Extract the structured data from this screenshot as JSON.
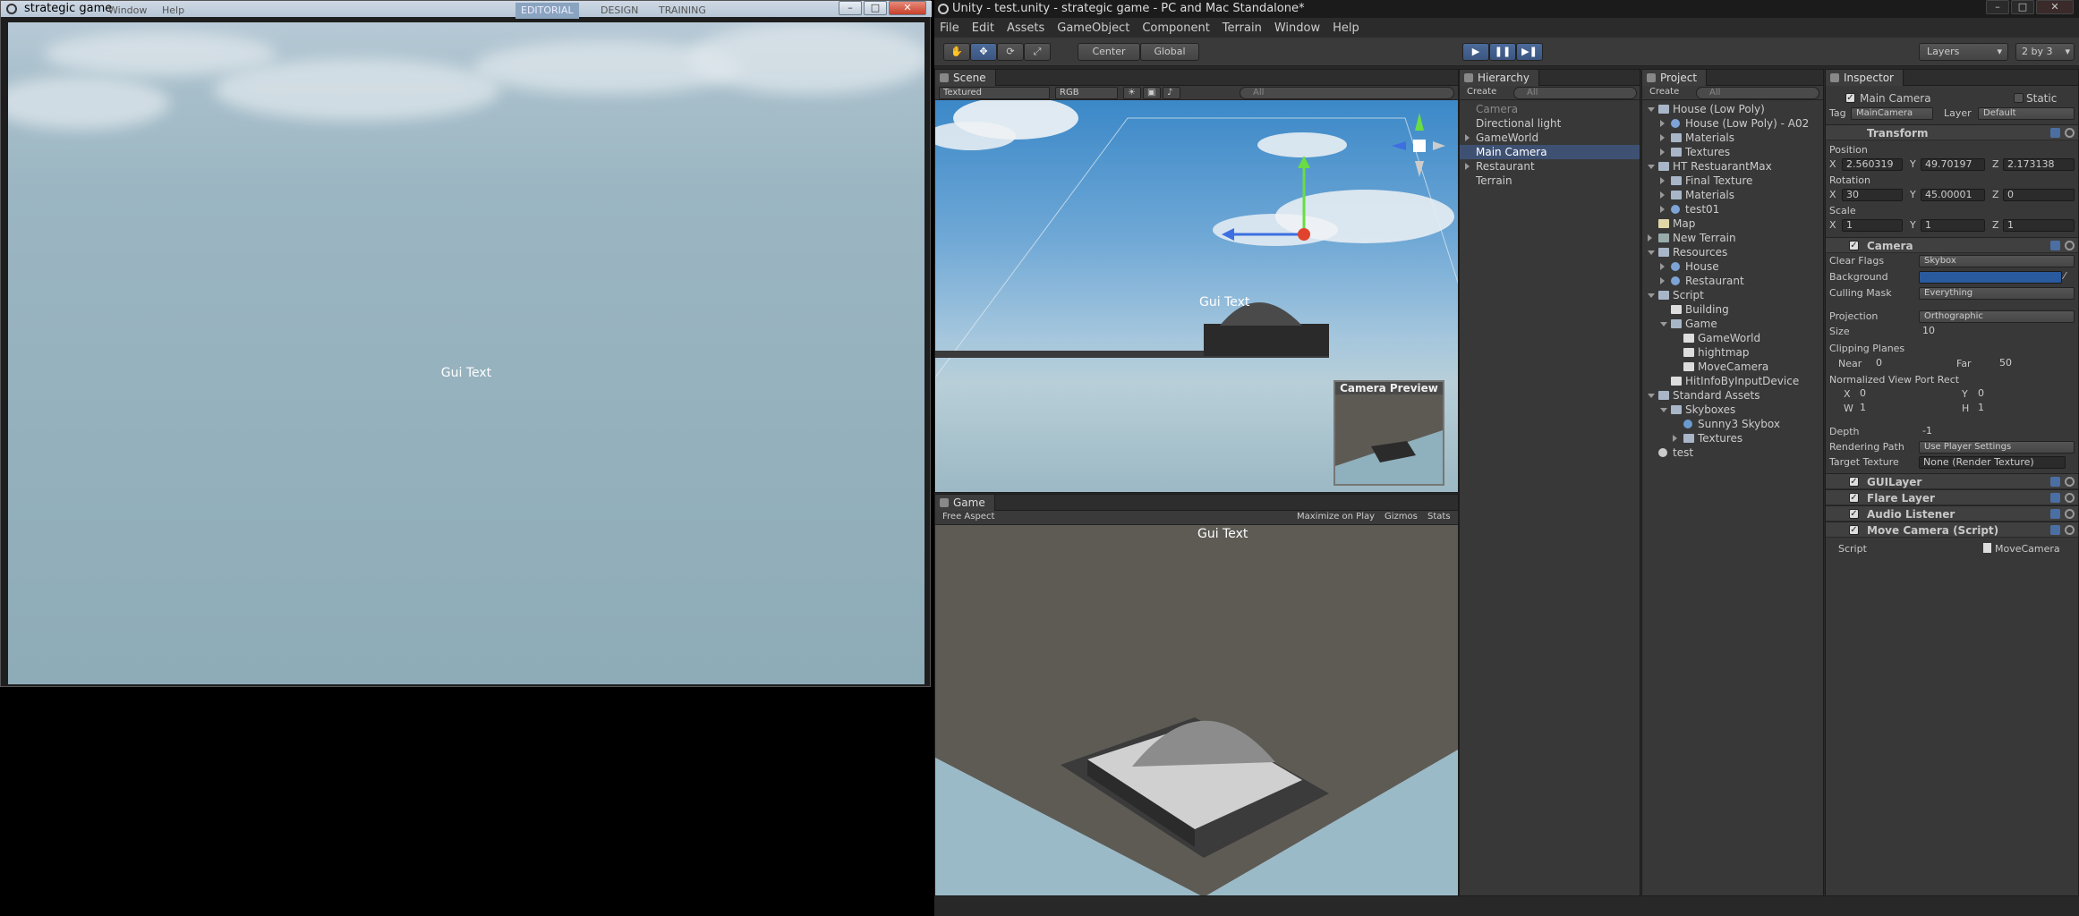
{
  "player": {
    "title": "strategic game",
    "ghost_menu": [
      "Window",
      "Help"
    ],
    "ghost_tabs": [
      "EDITORIAL",
      "DESIGN",
      "TRAINING"
    ],
    "gui_text": "Gui Text",
    "buttons": {
      "minimize": "–",
      "maximize": "□",
      "close": "✕"
    }
  },
  "editor": {
    "title": "Unity - test.unity - strategic game - PC and Mac Standalone*",
    "menu": [
      "File",
      "Edit",
      "Assets",
      "GameObject",
      "Component",
      "Terrain",
      "Window",
      "Help"
    ],
    "toolbar": {
      "center": "Center",
      "global": "Global",
      "layers": "Layers",
      "layout": "2 by 3"
    },
    "scene": {
      "tab": "Scene",
      "render_mode": "Textured",
      "color_mode": "RGB",
      "search": "All",
      "gui_text": "Gui Text",
      "camera_preview": "Camera Preview"
    },
    "game": {
      "tab": "Game",
      "aspect": "Free Aspect",
      "maximize": "Maximize on Play",
      "gizmos": "Gizmos",
      "stats": "Stats",
      "gui_text": "Gui Text"
    },
    "hierarchy": {
      "tab": "Hierarchy",
      "create": "Create",
      "search": "All",
      "items": [
        {
          "label": "Camera",
          "indent": 0,
          "fold": "none",
          "dim": true
        },
        {
          "label": "Directional light",
          "indent": 0,
          "fold": "none"
        },
        {
          "label": "GameWorld",
          "indent": 0,
          "fold": "closed"
        },
        {
          "label": "Main Camera",
          "indent": 0,
          "fold": "none",
          "selected": true
        },
        {
          "label": "Restaurant",
          "indent": 0,
          "fold": "closed"
        },
        {
          "label": "Terrain",
          "indent": 0,
          "fold": "none"
        }
      ]
    },
    "project": {
      "tab": "Project",
      "create": "Create",
      "search": "All",
      "items": [
        {
          "label": "House (Low Poly)",
          "indent": 0,
          "fold": "open",
          "icon": "folder"
        },
        {
          "label": "House (Low Poly) - A02",
          "indent": 1,
          "fold": "closed",
          "icon": "prefab"
        },
        {
          "label": "Materials",
          "indent": 1,
          "fold": "closed",
          "icon": "folder"
        },
        {
          "label": "Textures",
          "indent": 1,
          "fold": "closed",
          "icon": "folder"
        },
        {
          "label": "HT RestuarantMax",
          "indent": 0,
          "fold": "open",
          "icon": "folder"
        },
        {
          "label": "Final Texture",
          "indent": 1,
          "fold": "closed",
          "icon": "folder"
        },
        {
          "label": "Materials",
          "indent": 1,
          "fold": "closed",
          "icon": "folder"
        },
        {
          "label": "test01",
          "indent": 1,
          "fold": "closed",
          "icon": "prefab"
        },
        {
          "label": "Map",
          "indent": 0,
          "fold": "none",
          "icon": "texture"
        },
        {
          "label": "New Terrain",
          "indent": 0,
          "fold": "closed",
          "icon": "terrain"
        },
        {
          "label": "Resources",
          "indent": 0,
          "fold": "open",
          "icon": "folder"
        },
        {
          "label": "House",
          "indent": 1,
          "fold": "closed",
          "icon": "prefab"
        },
        {
          "label": "Restaurant",
          "indent": 1,
          "fold": "closed",
          "icon": "prefab"
        },
        {
          "label": "Script",
          "indent": 0,
          "fold": "open",
          "icon": "folder"
        },
        {
          "label": "Building",
          "indent": 1,
          "fold": "none",
          "icon": "script"
        },
        {
          "label": "Game",
          "indent": 1,
          "fold": "open",
          "icon": "folder"
        },
        {
          "label": "GameWorld",
          "indent": 2,
          "fold": "none",
          "icon": "script"
        },
        {
          "label": "hightmap",
          "indent": 2,
          "fold": "none",
          "icon": "script"
        },
        {
          "label": "MoveCamera",
          "indent": 2,
          "fold": "none",
          "icon": "script"
        },
        {
          "label": "HitInfoByInputDevice",
          "indent": 1,
          "fold": "none",
          "icon": "script"
        },
        {
          "label": "Standard Assets",
          "indent": 0,
          "fold": "open",
          "icon": "folder"
        },
        {
          "label": "Skyboxes",
          "indent": 1,
          "fold": "open",
          "icon": "folder"
        },
        {
          "label": "Sunny3 Skybox",
          "indent": 2,
          "fold": "none",
          "icon": "material"
        },
        {
          "label": "Textures",
          "indent": 2,
          "fold": "closed",
          "icon": "folder"
        },
        {
          "label": "test",
          "indent": 0,
          "fold": "none",
          "icon": "unity"
        }
      ]
    },
    "inspector": {
      "tab": "Inspector",
      "object_name": "Main Camera",
      "static": "Static",
      "tag_label": "Tag",
      "tag": "MainCamera",
      "layer_label": "Layer",
      "layer": "Default",
      "transform": {
        "title": "Transform",
        "position_label": "Position",
        "position": {
          "x": "2.560319",
          "y": "49.70197",
          "z": "2.173138"
        },
        "rotation_label": "Rotation",
        "rotation": {
          "x": "30",
          "y": "45.00001",
          "z": "0"
        },
        "scale_label": "Scale",
        "scale": {
          "x": "1",
          "y": "1",
          "z": "1"
        }
      },
      "camera": {
        "title": "Camera",
        "clear_flags_label": "Clear Flags",
        "clear_flags": "Skybox",
        "background_label": "Background",
        "background_color": "#2a5a9e",
        "culling_label": "Culling Mask",
        "culling": "Everything",
        "projection_label": "Projection",
        "projection": "Orthographic",
        "size_label": "Size",
        "size": "10",
        "clipping_label": "Clipping Planes",
        "near_label": "Near",
        "near": "0",
        "far_label": "Far",
        "far": "50",
        "viewport_label": "Normalized View Port Rect",
        "vp": {
          "x": "0",
          "y": "0",
          "w": "1",
          "h": "1"
        },
        "depth_label": "Depth",
        "depth": "-1",
        "rendering_label": "Rendering Path",
        "rendering": "Use Player Settings",
        "target_label": "Target Texture",
        "target": "None (Render Texture)"
      },
      "components": [
        {
          "title": "GUILayer"
        },
        {
          "title": "Flare Layer"
        },
        {
          "title": "Audio Listener"
        },
        {
          "title": "Move Camera (Script)"
        }
      ],
      "script_label": "Script",
      "script": "MoveCamera"
    }
  }
}
